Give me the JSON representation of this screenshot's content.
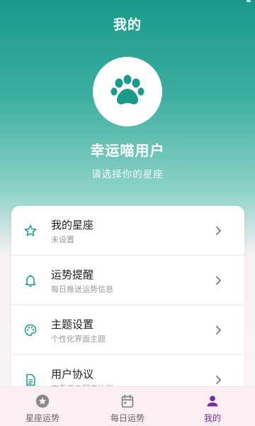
{
  "header": {
    "title": "我的"
  },
  "profile": {
    "avatar_icon": "paw-icon",
    "name": "幸运喵用户",
    "subtitle": "请选择你的星座"
  },
  "menu": {
    "items": [
      {
        "icon": "star-outline-icon",
        "title": "我的星座",
        "subtitle": "未设置"
      },
      {
        "icon": "bell-icon",
        "title": "运势提醒",
        "subtitle": "每日推送运势信息"
      },
      {
        "icon": "palette-icon",
        "title": "主题设置",
        "subtitle": "个性化界面主题"
      },
      {
        "icon": "document-icon",
        "title": "用户协议",
        "subtitle": "查看用户服务协议"
      }
    ]
  },
  "bottom_nav": {
    "items": [
      {
        "icon": "star-circle-icon",
        "label": "星座运势",
        "active": false
      },
      {
        "icon": "calendar-icon",
        "label": "每日运势",
        "active": false
      },
      {
        "icon": "person-icon",
        "label": "我的",
        "active": true
      }
    ]
  },
  "colors": {
    "accent": "#1a9a8b",
    "active_nav": "#7b2a9b",
    "nav_bg": "#fbeef4"
  }
}
